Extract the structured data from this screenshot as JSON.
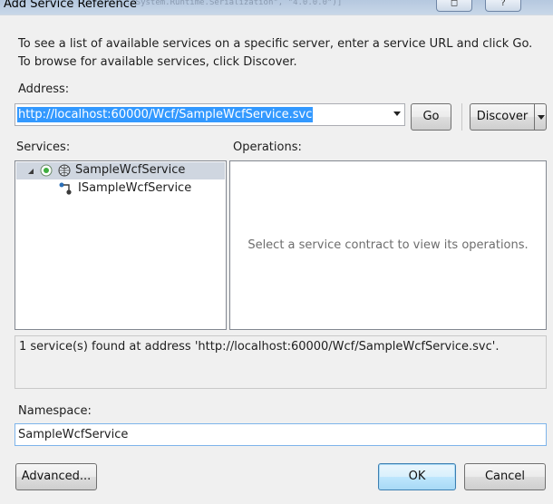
{
  "window": {
    "title": "Add Service Reference",
    "background_code": "...\"System.Runtime.Serialization\", \"4.0.0.0\")]"
  },
  "instructions": "To see a list of available services on a specific server, enter a service URL and click Go. To browse for available services, click Discover.",
  "address": {
    "label": "Address:",
    "value": "http://localhost:60000/Wcf/SampleWcfService.svc",
    "go_label": "Go",
    "discover_label": "Discover"
  },
  "services": {
    "label": "Services:",
    "tree": [
      {
        "label": "SampleWcfService",
        "icon": "service-icon",
        "expanded": true,
        "selected": true
      },
      {
        "label": "ISampleWcfService",
        "icon": "contract-icon"
      }
    ]
  },
  "operations": {
    "label": "Operations:",
    "placeholder": "Select a service contract to view its operations."
  },
  "status_message": "1 service(s) found at address 'http://localhost:60000/Wcf/SampleWcfService.svc'.",
  "namespace": {
    "label": "Namespace:",
    "value": "SampleWcfService"
  },
  "buttons": {
    "advanced": "Advanced...",
    "ok": "OK",
    "cancel": "Cancel"
  },
  "colors": {
    "selection": "#3399ff",
    "tree_selection": "#cfd6e0",
    "focus_border": "#7eb4ea"
  }
}
